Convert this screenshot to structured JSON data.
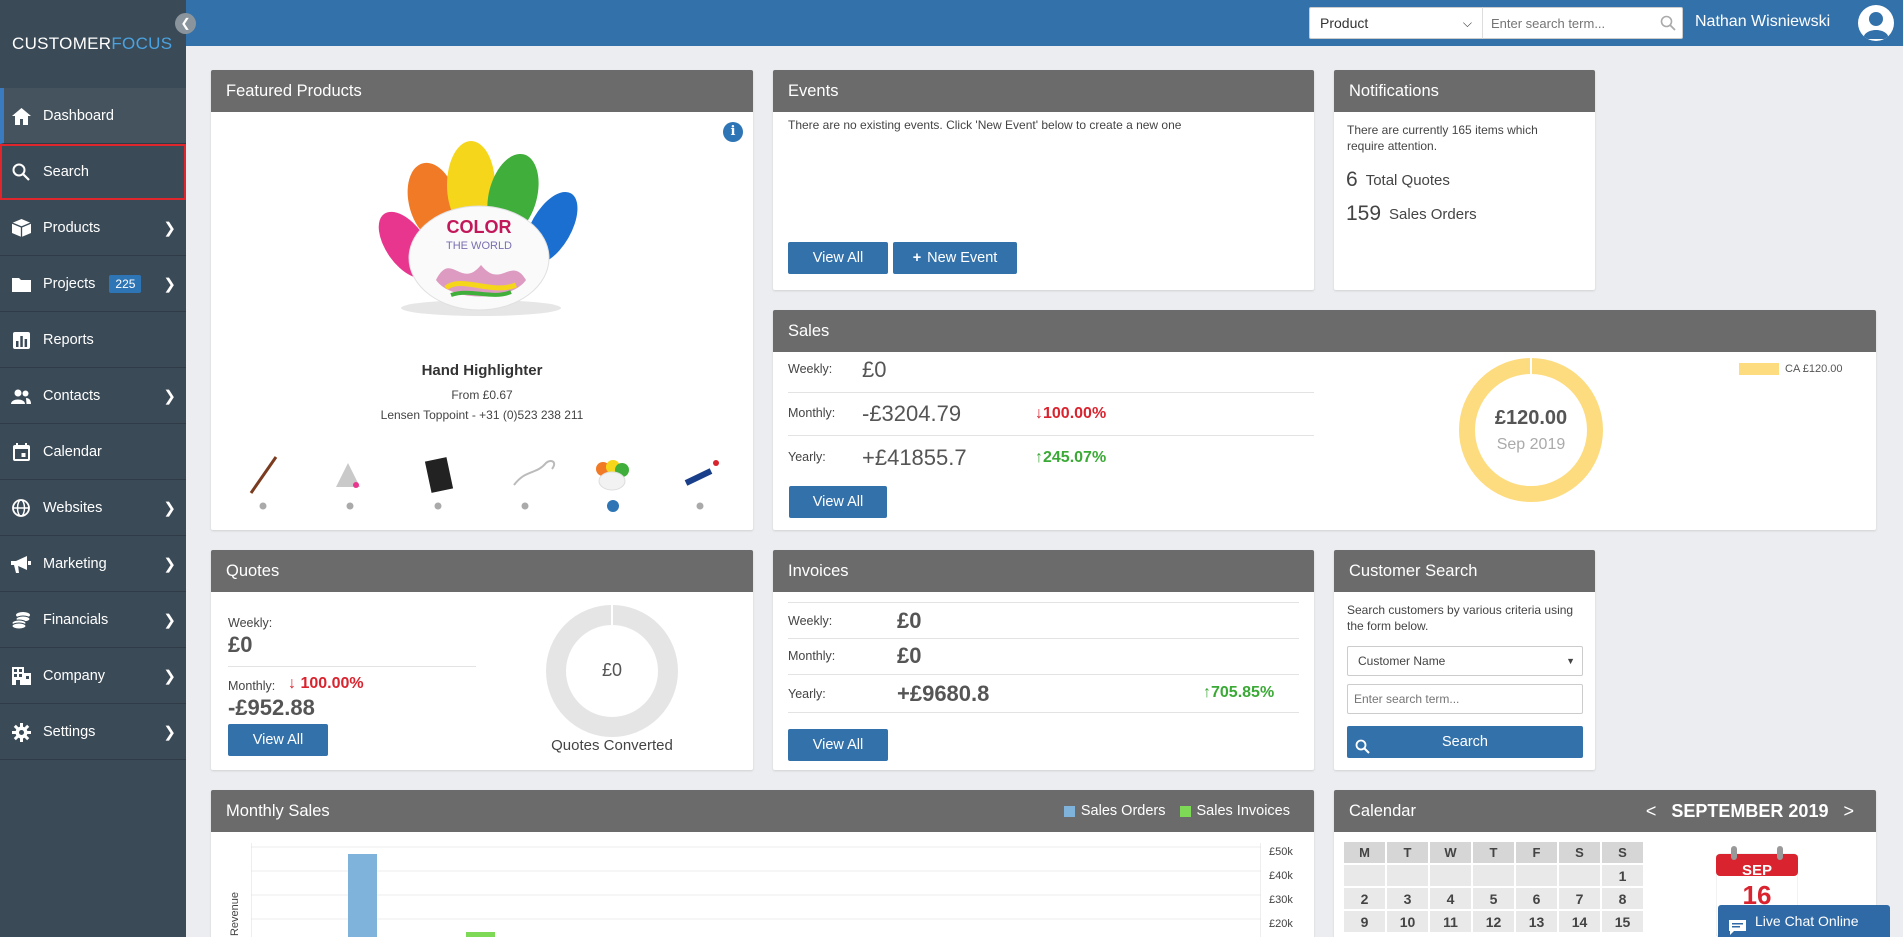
{
  "app": {
    "logo_part1": "CUSTOMER",
    "logo_part2": "FOCUS"
  },
  "sidebar": {
    "items": [
      {
        "label": "Dashboard",
        "icon": "home-icon"
      },
      {
        "label": "Search",
        "icon": "search-icon"
      },
      {
        "label": "Products",
        "icon": "box-icon"
      },
      {
        "label": "Projects",
        "icon": "folder-icon",
        "badge": "225"
      },
      {
        "label": "Reports",
        "icon": "chart-icon"
      },
      {
        "label": "Contacts",
        "icon": "people-icon"
      },
      {
        "label": "Calendar",
        "icon": "calendar-icon"
      },
      {
        "label": "Websites",
        "icon": "globe-icon"
      },
      {
        "label": "Marketing",
        "icon": "megaphone-icon"
      },
      {
        "label": "Financials",
        "icon": "coins-icon"
      },
      {
        "label": "Company",
        "icon": "building-icon"
      },
      {
        "label": "Settings",
        "icon": "gear-icon"
      }
    ]
  },
  "header": {
    "search_type": "Product",
    "search_placeholder": "Enter search term...",
    "user_name": "Nathan Wisniewski"
  },
  "featured": {
    "title": "Featured Products",
    "product_name": "Hand Highlighter",
    "price": "From £0.67",
    "supplier": "Lensen Toppoint - +31 (0)523 238 211",
    "logo_text1": "COLOR",
    "logo_text2": "THE WORLD"
  },
  "events": {
    "title": "Events",
    "message": "There are no existing events. Click 'New Event' below to create a new one",
    "view_all": "View All",
    "new_event": "New Event"
  },
  "notifications": {
    "title": "Notifications",
    "message": "There are currently 165 items which require attention.",
    "items": [
      {
        "count": "6",
        "label": "Total Quotes"
      },
      {
        "count": "159",
        "label": "Sales Orders"
      }
    ]
  },
  "sales": {
    "title": "Sales",
    "weekly_label": "Weekly:",
    "weekly_value": "£0",
    "monthly_label": "Monthly:",
    "monthly_value": "-£3204.79",
    "monthly_change": "100.00%",
    "yearly_label": "Yearly:",
    "yearly_value": "+£41855.7",
    "yearly_change": "245.07%",
    "view_all": "View All",
    "donut_value": "£120.00",
    "donut_period": "Sep 2019",
    "legend_label": "CA £120.00",
    "donut_color": "#fddb7f"
  },
  "quotes": {
    "title": "Quotes",
    "weekly_label": "Weekly:",
    "weekly_value": "£0",
    "monthly_label": "Monthly:",
    "monthly_change": "100.00%",
    "monthly_value": "-£952.88",
    "view_all": "View All",
    "donut_value": "£0",
    "donut_caption": "Quotes Converted"
  },
  "invoices": {
    "title": "Invoices",
    "weekly_label": "Weekly:",
    "weekly_value": "£0",
    "monthly_label": "Monthly:",
    "monthly_value": "£0",
    "yearly_label": "Yearly:",
    "yearly_value": "+£9680.8",
    "yearly_change": "705.85%",
    "view_all": "View All"
  },
  "customer_search": {
    "title": "Customer Search",
    "message": "Search customers by various criteria using the form below.",
    "criteria": "Customer Name",
    "placeholder": "Enter search term...",
    "button": "Search"
  },
  "monthly_sales": {
    "title": "Monthly Sales",
    "legend": [
      "Sales Orders",
      "Sales Invoices"
    ],
    "ylabel": "Revenue",
    "y_ticks": [
      "£50k",
      "£40k",
      "£30k",
      "£20k"
    ],
    "colors": {
      "orders": "#7fb3db",
      "invoices": "#7ed957"
    }
  },
  "calendar": {
    "title": "Calendar",
    "month": "SEPTEMBER 2019",
    "prev": "<",
    "next": ">",
    "day_headers": [
      "M",
      "T",
      "W",
      "T",
      "F",
      "S",
      "S"
    ],
    "weeks": [
      [
        "",
        "",
        "",
        "",
        "",
        "",
        "1"
      ],
      [
        "2",
        "3",
        "4",
        "5",
        "6",
        "7",
        "8"
      ],
      [
        "9",
        "10",
        "11",
        "12",
        "13",
        "14",
        "15"
      ]
    ],
    "today_month": "SEP",
    "today_day": "16"
  },
  "chat": {
    "label": "Live Chat Online"
  }
}
